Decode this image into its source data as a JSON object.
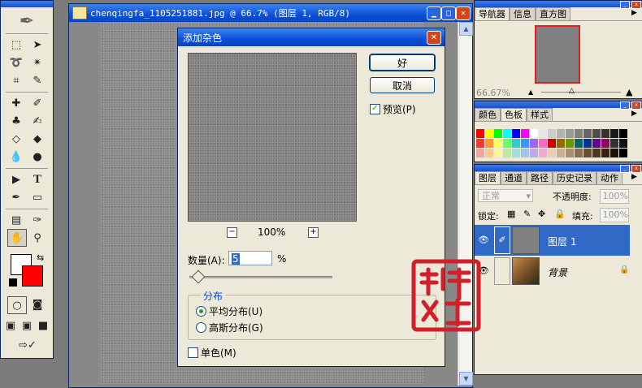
{
  "document": {
    "title": "chenqingfa_1105251881.jpg @ 66.7% (图层 1, RGB/8)",
    "minimize_glyph": "▁",
    "maximize_glyph": "□",
    "close_glyph": "✕"
  },
  "dialog": {
    "title": "添加杂色",
    "ok_label": "好",
    "cancel_label": "取消",
    "preview_label": "预览(P)",
    "preview_checked": true,
    "zoom_out": "−",
    "zoom_in": "+",
    "zoom_level": "100%",
    "amount_label": "数量(A):",
    "amount_value": "5",
    "amount_unit": "%",
    "amount_slider_fraction": 0.03,
    "distribution_label": "分布",
    "uniform_label": "平均分布(U)",
    "gaussian_label": "高斯分布(G)",
    "selected_distribution": "uniform",
    "monochromatic_label": "单色(M)",
    "monochromatic_checked": false,
    "close_glyph": "✕"
  },
  "navigator": {
    "tabs": [
      "导航器",
      "信息",
      "直方图"
    ],
    "zoom": "66.67%"
  },
  "color_panel": {
    "tabs": [
      "颜色",
      "色板",
      "样式"
    ]
  },
  "layers_panel": {
    "tabs": [
      "图层",
      "通道",
      "路径",
      "历史记录",
      "动作"
    ],
    "blend_mode": "正常",
    "opacity_label": "不透明度:",
    "opacity_value": "100%",
    "lock_label": "锁定:",
    "fill_label": "填充:",
    "fill_value": "100%",
    "layers": [
      {
        "name": "图层 1",
        "selected": true,
        "visible": true
      },
      {
        "name": "背景",
        "selected": false,
        "visible": true,
        "locked": true
      }
    ]
  },
  "swatch_colors": [
    "#ff0000",
    "#ffff00",
    "#00ff00",
    "#00ffff",
    "#0000ff",
    "#ff00ff",
    "#ffffff",
    "#e6e6e6",
    "#cccccc",
    "#b3b3b3",
    "#999999",
    "#808080",
    "#666666",
    "#4d4d4d",
    "#333333",
    "#1a1a1a",
    "#000000",
    "#ff3333",
    "#ff9933",
    "#ffff66",
    "#66ff66",
    "#33cccc",
    "#3399ff",
    "#9966ff",
    "#ff66cc",
    "#cc0000",
    "#996600",
    "#669900",
    "#006666",
    "#003399",
    "#660099",
    "#990066",
    "#333333",
    "#111111",
    "#f4a3a3",
    "#f9c98f",
    "#fff3a0",
    "#bfe8a0",
    "#a0e0d8",
    "#a0c4f0",
    "#c0a8e8",
    "#f0a8d0",
    "#e8d0b0",
    "#c8b090",
    "#a89070",
    "#887050",
    "#685030",
    "#503820",
    "#382010",
    "#201008",
    "#000000"
  ],
  "colors": {
    "title_bar": "#0b4fd6",
    "foreground": "#ffffff",
    "background": "#ff0000",
    "layer_selected": "#3169c6",
    "seal": "#d0202a"
  },
  "seal_text": "教程网"
}
